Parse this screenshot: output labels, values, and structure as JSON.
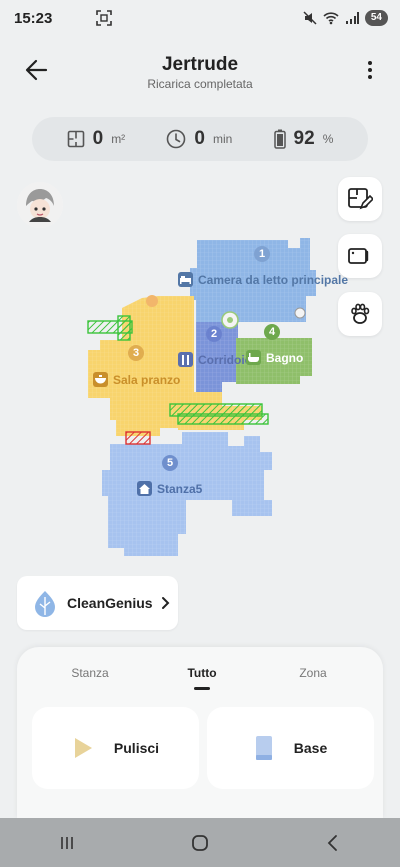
{
  "status_bar": {
    "time": "15:23",
    "battery": "54",
    "icons": [
      "screenshot-icon",
      "mute-icon",
      "wifi-icon",
      "signal-icon"
    ]
  },
  "header": {
    "title": "Jertrude",
    "subtitle": "Ricarica completata",
    "back_icon": "arrow-left-icon",
    "more_icon": "more-vertical-icon"
  },
  "stats": {
    "area_value": "0",
    "area_unit": "m²",
    "time_value": "0",
    "time_unit": "min",
    "battery_value": "92",
    "battery_unit": "%"
  },
  "side_buttons": [
    "map-edit-icon",
    "video-camera-icon",
    "pet-paw-icon"
  ],
  "map": {
    "rooms": [
      {
        "number": "1",
        "name": "Camera da letto principale",
        "color": "#8fb6e6",
        "label_color": "#5377a6",
        "num_color": "#7fa2d2"
      },
      {
        "number": "2",
        "name": "Corridoio",
        "color": "#7b94d9",
        "label_color": "#5a6fae",
        "num_color": "#6b82cf"
      },
      {
        "number": "3",
        "name": "Sala pranzo",
        "color": "#f8d46d",
        "label_color": "#c98f2a",
        "num_color": "#e0ad4f"
      },
      {
        "number": "4",
        "name": "Bagno",
        "color": "#8fbf6a",
        "label_color": "#ffffff",
        "num_color": "#6ea84d"
      },
      {
        "number": "5",
        "name": "Stanza5",
        "color": "#a7c3ef",
        "label_color": "#4f70a8",
        "num_color": "#6f8fcd"
      }
    ]
  },
  "clean_genius": {
    "label": "CleanGenius",
    "icon": "leaf-icon",
    "chevron": "chevron-right-icon"
  },
  "tabs": [
    {
      "label": "Stanza",
      "active": false
    },
    {
      "label": "Tutto",
      "active": true
    },
    {
      "label": "Zona",
      "active": false
    }
  ],
  "actions": {
    "start_label": "Pulisci",
    "start_icon": "play-icon",
    "base_label": "Base",
    "base_icon": "base-station-icon"
  },
  "navbar": [
    "recents-icon",
    "home-icon",
    "back-icon"
  ]
}
